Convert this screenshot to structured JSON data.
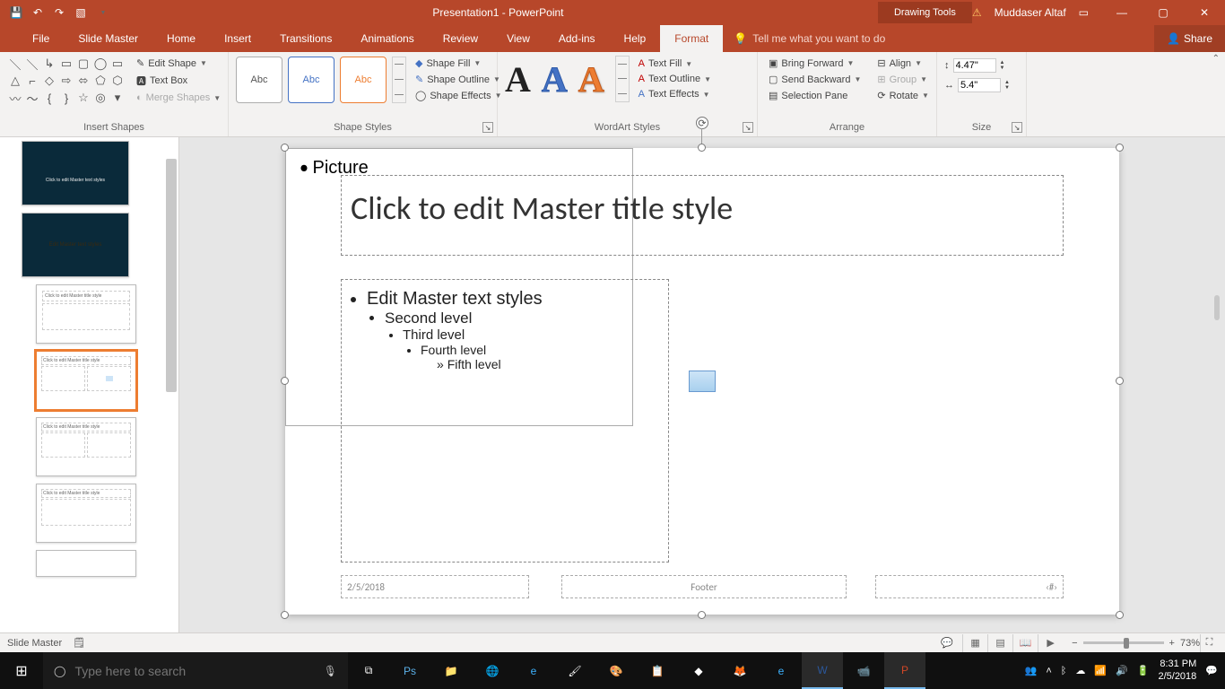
{
  "titlebar": {
    "title": "Presentation1 - PowerPoint",
    "context_tab": "Drawing Tools",
    "username": "Muddaser Altaf"
  },
  "menubar": {
    "tabs": [
      "File",
      "Slide Master",
      "Home",
      "Insert",
      "Transitions",
      "Animations",
      "Review",
      "View",
      "Add-ins",
      "Help",
      "Format"
    ],
    "active_tab": "Format",
    "tellme": "Tell me what you want to do",
    "share": "Share"
  },
  "ribbon": {
    "insert_shapes": {
      "label": "Insert Shapes",
      "edit_shape": "Edit Shape",
      "text_box": "Text Box",
      "merge_shapes": "Merge Shapes"
    },
    "shape_styles": {
      "label": "Shape Styles",
      "sample": "Abc",
      "shape_fill": "Shape Fill",
      "shape_outline": "Shape Outline",
      "shape_effects": "Shape Effects"
    },
    "wordart_styles": {
      "label": "WordArt Styles",
      "sample": "A",
      "text_fill": "Text Fill",
      "text_outline": "Text Outline",
      "text_effects": "Text Effects"
    },
    "arrange": {
      "label": "Arrange",
      "bring_forward": "Bring Forward",
      "send_backward": "Send Backward",
      "selection_pane": "Selection Pane",
      "align": "Align",
      "group": "Group",
      "rotate": "Rotate"
    },
    "size": {
      "label": "Size",
      "height": "4.47\"",
      "width": "5.4\""
    }
  },
  "slide": {
    "title": "Click to edit Master title style",
    "level1": "Edit Master text styles",
    "level2": "Second level",
    "level3": "Third level",
    "level4": "Fourth level",
    "level5": "Fifth level",
    "picture_label": "Picture",
    "date": "2/5/2018",
    "footer": "Footer",
    "slidenum": "‹#›"
  },
  "thumbnails": {
    "t3_title": "Click to edit Master title style",
    "t4_title": "Click to edit Master title style",
    "t5_title": "Click to edit Master title style",
    "t6_title": "Click to edit Master title style",
    "t2_title": "Edit Master text styles"
  },
  "statusbar": {
    "mode": "Slide Master",
    "zoom": "73%"
  },
  "taskbar": {
    "search_placeholder": "Type here to search",
    "time": "8:31 PM",
    "date": "2/5/2018"
  }
}
